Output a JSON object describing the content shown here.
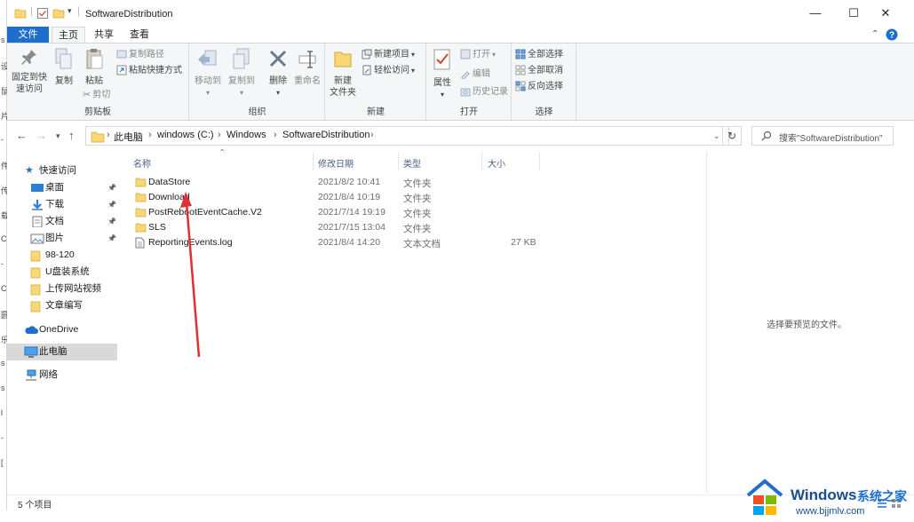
{
  "window": {
    "title": "SoftwareDistribution",
    "minimize": "—",
    "maximize": "☐",
    "close": "✕"
  },
  "left_edge_chars": [
    "s",
    "设",
    "鼠",
    "片",
    "-",
    "件",
    "传",
    "载",
    "C",
    "-",
    "C",
    "圆",
    "乐",
    "s",
    "s",
    "l",
    "-",
    "["
  ],
  "tabs": {
    "file": "文件",
    "home": "主页",
    "share": "共享",
    "view": "查看"
  },
  "ribbon": {
    "clipboard": {
      "label": "剪贴板",
      "pin": "固定到快\n速访问",
      "copy": "复制",
      "paste": "粘贴",
      "copy_path": "复制路径",
      "paste_shortcut": "粘贴快捷方式",
      "cut": "剪切"
    },
    "organize": {
      "label": "组织",
      "move_to": "移动到",
      "copy_to": "复制到",
      "delete": "删除",
      "rename": "重命名"
    },
    "new": {
      "label": "新建",
      "new_folder": "新建\n文件夹",
      "new_item": "新建项目",
      "easy_access": "轻松访问"
    },
    "open": {
      "label": "打开",
      "properties": "属性",
      "open": "打开",
      "edit": "编辑",
      "history": "历史记录"
    },
    "select": {
      "label": "选择",
      "select_all": "全部选择",
      "select_none": "全部取消",
      "invert": "反向选择"
    }
  },
  "address": {
    "crumbs": [
      "此电脑",
      "windows (C:)",
      "Windows",
      "SoftwareDistribution"
    ],
    "search_placeholder": "搜索\"SoftwareDistribution\""
  },
  "nav": {
    "quick_access": "快速访问",
    "items": [
      {
        "label": "桌面",
        "pinned": true
      },
      {
        "label": "下载",
        "pinned": true
      },
      {
        "label": "文档",
        "pinned": true
      },
      {
        "label": "图片",
        "pinned": true
      },
      {
        "label": "98-120",
        "pinned": false
      },
      {
        "label": "U盘装系统",
        "pinned": false
      },
      {
        "label": "上传网站视频",
        "pinned": false
      },
      {
        "label": "文章编写",
        "pinned": false
      }
    ],
    "onedrive": "OneDrive",
    "this_pc": "此电脑",
    "network": "网络"
  },
  "columns": {
    "name": "名称",
    "date": "修改日期",
    "type": "类型",
    "size": "大小"
  },
  "files": [
    {
      "name": "DataStore",
      "date": "2021/8/2 10:41",
      "type": "文件夹",
      "size": "",
      "kind": "folder"
    },
    {
      "name": "Download",
      "date": "2021/8/4 10:19",
      "type": "文件夹",
      "size": "",
      "kind": "folder"
    },
    {
      "name": "PostRebootEventCache.V2",
      "date": "2021/7/14 19:19",
      "type": "文件夹",
      "size": "",
      "kind": "folder"
    },
    {
      "name": "SLS",
      "date": "2021/7/15 13:04",
      "type": "文件夹",
      "size": "",
      "kind": "folder"
    },
    {
      "name": "ReportingEvents.log",
      "date": "2021/8/4 14:20",
      "type": "文本文档",
      "size": "27 KB",
      "kind": "file"
    }
  ],
  "preview_text": "选择要预览的文件。",
  "status": "5 个项目",
  "watermark": {
    "brand": "Windows",
    "brand_cn": "系统之家",
    "url": "www.bjjmlv.com"
  },
  "colors": {
    "accent": "#1e6fcb",
    "folder": "#f8d775",
    "arrow": "#e03131"
  }
}
